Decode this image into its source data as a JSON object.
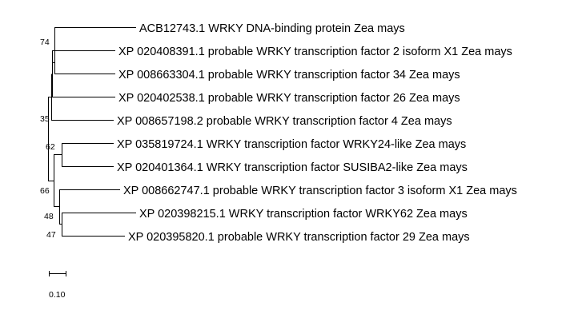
{
  "tree": {
    "taxa": [
      {
        "id": "t1",
        "label": "ACB12743.1 WRKY DNA-binding protein Zea mays"
      },
      {
        "id": "t2",
        "label": "XP 020408391.1 probable WRKY transcription factor 2 isoform X1 Zea mays"
      },
      {
        "id": "t3",
        "label": "XP 008663304.1 probable WRKY transcription factor 34 Zea mays"
      },
      {
        "id": "t4",
        "label": "XP 020402538.1 probable WRKY transcription factor 26 Zea mays"
      },
      {
        "id": "t5",
        "label": "XP 008657198.2 probable WRKY transcription factor 4 Zea mays"
      },
      {
        "id": "t6",
        "label": "XP 035819724.1 WRKY transcription factor WRKY24-like Zea mays"
      },
      {
        "id": "t7",
        "label": "XP 020401364.1 WRKY transcription factor SUSIBA2-like Zea mays"
      },
      {
        "id": "t8",
        "label": "XP 008662747.1 probable WRKY transcription factor 3 isoform X1 Zea mays"
      },
      {
        "id": "t9",
        "label": "XP 020398215.1 WRKY transcription factor WRKY62 Zea mays"
      },
      {
        "id": "t10",
        "label": "XP 020395820.1 probable WRKY transcription factor 29 Zea mays"
      }
    ],
    "support_values": [
      {
        "node": "n_t1_t2_t3",
        "value": "74"
      },
      {
        "node": "n_upper",
        "value": "35"
      },
      {
        "node": "n_t6_t7",
        "value": "62"
      },
      {
        "node": "n_lower",
        "value": "66"
      },
      {
        "node": "n_t8_t9_t10",
        "value": "48"
      },
      {
        "node": "n_t9_t10",
        "value": "47"
      }
    ],
    "scale_bar": {
      "label": "0.10"
    }
  }
}
